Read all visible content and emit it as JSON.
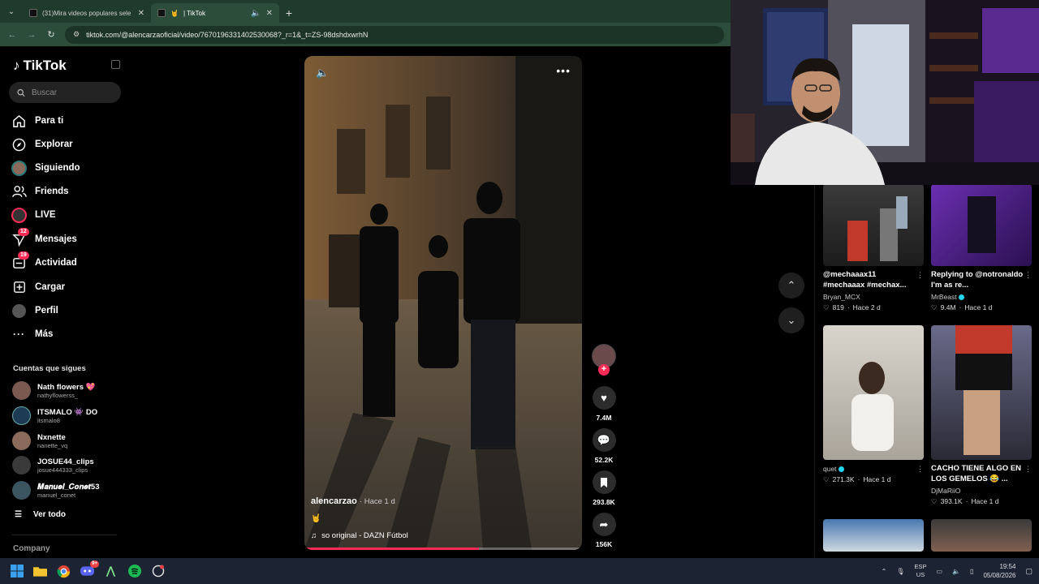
{
  "browser": {
    "tabs": [
      {
        "title": "(31)Mira videos populares sele",
        "active": false
      },
      {
        "title": "| TikTok",
        "active": true
      }
    ],
    "url": "tiktok.com/@alencarzaoficial/video/7670196331402530068?_r=1&_t=ZS-98dshdxwrhN"
  },
  "sidebar": {
    "logo": "TikTok",
    "search_placeholder": "Buscar",
    "nav": [
      {
        "label": "Para ti",
        "icon": "home-icon"
      },
      {
        "label": "Explorar",
        "icon": "compass-icon"
      },
      {
        "label": "Siguiendo",
        "icon": "following-avatar-icon"
      },
      {
        "label": "Friends",
        "icon": "friends-icon"
      },
      {
        "label": "LIVE",
        "icon": "live-icon"
      },
      {
        "label": "Mensajes",
        "icon": "messages-icon",
        "badge": "12"
      },
      {
        "label": "Actividad",
        "icon": "activity-icon",
        "badge": "19"
      },
      {
        "label": "Cargar",
        "icon": "upload-icon"
      },
      {
        "label": "Perfil",
        "icon": "profile-icon"
      },
      {
        "label": "Más",
        "icon": "more-icon"
      }
    ],
    "following_title": "Cuentas que sigues",
    "following": [
      {
        "name": "Nath flowers 💖",
        "handle": "nathyflowerss_",
        "color": "#7a5a50"
      },
      {
        "name": "ITSMALO 👾 DO",
        "handle": "itsmalo8",
        "color": "#1d3b55"
      },
      {
        "name": "Nxnette",
        "handle": "nanette_vq",
        "color": "#8a6a5a"
      },
      {
        "name": "JOSUE44_clips",
        "handle": "josue444333_clips",
        "color": "#3a3a3a"
      },
      {
        "name": "𝑴𝒂𝒏𝒖𝒆𝒍_𝑪𝒐𝒏𝒆𝒕53",
        "handle": "manuel_conet",
        "color": "#3b5560"
      }
    ],
    "see_all": "Ver todo",
    "company": "Company"
  },
  "video": {
    "author": "alencarzao",
    "time": "· Hace 1 d",
    "caption": "🤘",
    "music": "so original - DAZN Fútbol",
    "progress": 0.63,
    "likes": "7.4M",
    "comments": "52.2K",
    "saves": "293.8K",
    "shares": "156K"
  },
  "recommended": [
    {
      "title": "@mechaaax11 #mechaaax #mechax...",
      "author": "Bryan_MCX",
      "verified": false,
      "likes": "819",
      "time": "Hace 2 d"
    },
    {
      "title": "Replying to @notronaldo I'm as re...",
      "author": "MrBeast",
      "verified": true,
      "likes": "9.4M",
      "time": "Hace 1 d"
    },
    {
      "title": "",
      "author": "quet",
      "verified": true,
      "likes": "271.3K",
      "time": "Hace 1 d"
    },
    {
      "title": "CACHO TIENE ALGO EN LOS GEMELOS 😂 ...",
      "author": "DjMaRiiO",
      "verified": false,
      "likes": "393.1K",
      "time": "Hace 1 d"
    }
  ],
  "taskbar": {
    "lang_top": "ESP",
    "lang_bottom": "US",
    "time": "19:54",
    "date": "05/08/2026",
    "discord_badge": "9+"
  },
  "colors": {
    "accent": "#fe2c55",
    "browser": "#2b4d3a",
    "taskbar": "#1c2433"
  }
}
